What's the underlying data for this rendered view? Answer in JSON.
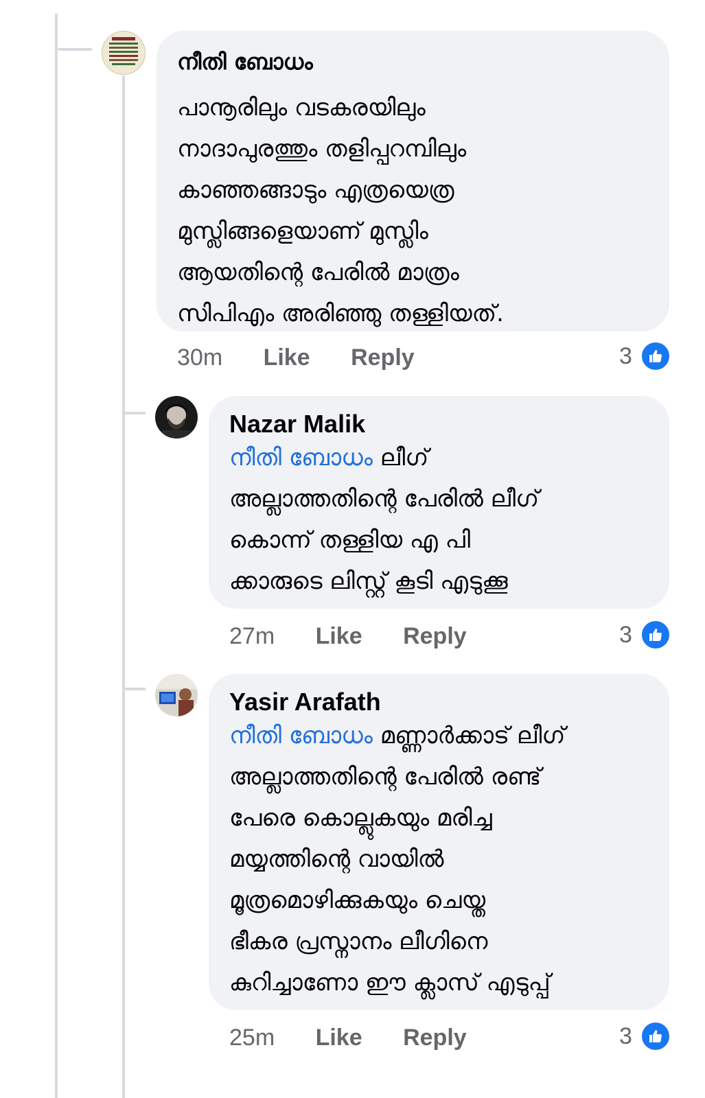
{
  "comments": [
    {
      "author": "നീതി ബോധം",
      "mention": "",
      "lines": [
        "പാനൂരിലും വടകരയിലും",
        "നാദാപുരത്തും തളിപ്പറമ്പിലും",
        "കാഞ്ഞങ്ങാടും എത്രയെത്ര",
        "മുസ്ലിങ്ങളെയാണ് മുസ്ലിം",
        "ആയതിന്റെ പേരിൽ മാത്രം",
        "സിപിഎം അരിഞ്ഞു തള്ളിയത്."
      ],
      "time": "30m",
      "like_label": "Like",
      "reply_label": "Reply",
      "reaction_count": "3",
      "reaction_icon": "thumbs-up-icon"
    },
    {
      "author": "Nazar Malik",
      "mention": "നീതി ബോധം",
      "first_line_rest": " ലീഗ്",
      "lines": [
        "അല്ലാത്തതിന്റെ പേരിൽ ലീഗ്",
        "കൊന്ന് തള്ളിയ എ പി",
        "ക്കാരുടെ ലിസ്റ്റ് കൂടി എടുക്കൂ"
      ],
      "time": "27m",
      "like_label": "Like",
      "reply_label": "Reply",
      "reaction_count": "3",
      "reaction_icon": "thumbs-up-icon"
    },
    {
      "author": "Yasir Arafath",
      "mention": "നീതി ബോധം",
      "first_line_rest": " മണ്ണാർക്കാട് ലീഗ്",
      "lines": [
        "അല്ലാത്തതിന്റെ പേരിൽ രണ്ട്",
        "പേരെ കൊല്ലുകയും മരിച്ച",
        "മയ്യത്തിന്റെ വായിൽ",
        "മൂത്രമൊഴിക്കുകയും ചെയ്ത",
        "ഭീകര പ്രസ്നാനം ലീഗിനെ",
        "കുറിച്ചാണോ ഈ ക്ലാസ് എടുപ്പ്"
      ],
      "time": "25m",
      "like_label": "Like",
      "reply_label": "Reply",
      "reaction_count": "3",
      "reaction_icon": "thumbs-up-icon"
    }
  ],
  "colors": {
    "bubble": "#f0f2f5",
    "mention": "#216fdb",
    "meta": "#65676b",
    "like": "#1877f2"
  }
}
